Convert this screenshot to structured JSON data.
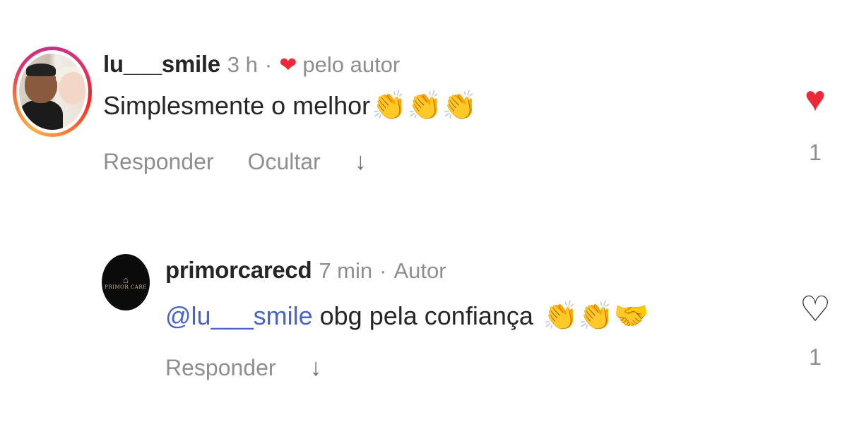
{
  "comments": [
    {
      "username": "lu___smile",
      "time": "3 h",
      "liked_by_author_label": "pelo autor",
      "text": "Simplesmente o melhor",
      "emojis": "👏👏👏",
      "actions": {
        "reply": "Responder",
        "hide": "Ocultar"
      },
      "like_count": "1",
      "liked": true
    },
    {
      "username": "primorcarecd",
      "time": "7 min",
      "author_label": "Autor",
      "avatar_text": "PRIMOR CARE",
      "mention": "@lu___smile",
      "text": "obg pela confiança",
      "emojis": "👏👏🤝",
      "actions": {
        "reply": "Responder"
      },
      "like_count": "1",
      "liked": false
    }
  ],
  "colors": {
    "heart_red": "#ed2939",
    "mention_blue": "#4a63c8",
    "muted_gray": "#8e8e8e",
    "text_dark": "#262626"
  },
  "icons": {
    "liked_heart": "heart-filled-icon",
    "unliked_heart": "heart-outline-icon",
    "arrow": "arrow-down-icon",
    "author_heart": "heart-filled-icon"
  }
}
